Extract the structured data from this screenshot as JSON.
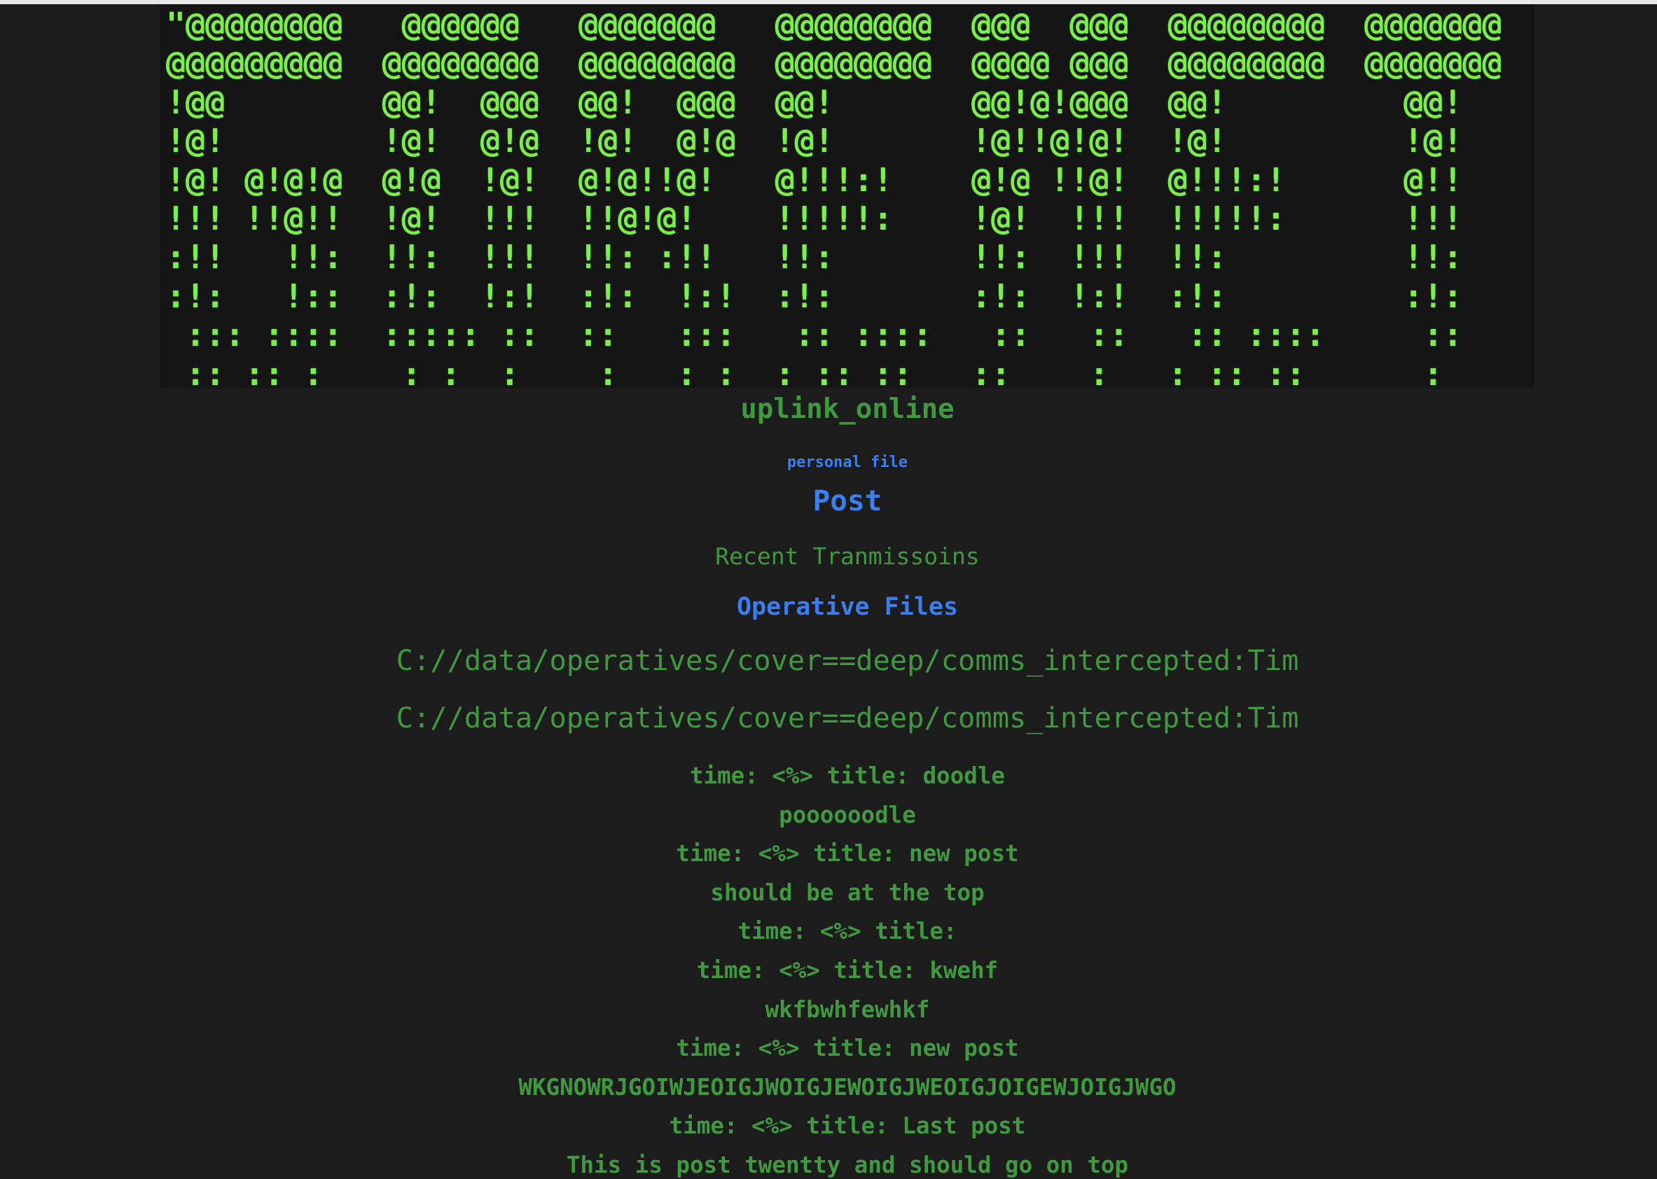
{
  "banner": {
    "lines": [
      "\"@@@@@@@@   @@@@@@   @@@@@@@   @@@@@@@@  @@@  @@@  @@@@@@@@  @@@@@@@",
      "@@@@@@@@@  @@@@@@@@  @@@@@@@@  @@@@@@@@  @@@@ @@@  @@@@@@@@  @@@@@@@",
      "!@@        @@!  @@@  @@!  @@@  @@!       @@!@!@@@  @@!         @@!",
      "!@!        !@!  @!@  !@!  @!@  !@!       !@!!@!@!  !@!         !@!",
      "!@! @!@!@  @!@  !@!  @!@!!@!   @!!!:!    @!@ !!@!  @!!!:!      @!!",
      "!!! !!@!!  !@!  !!!  !!@!@!    !!!!!:    !@!  !!!  !!!!!:      !!!",
      ":!!   !!:  !!:  !!!  !!: :!!   !!:       !!:  !!!  !!:         !!:",
      ":!:   !::  :!:  !:!  :!:  !:!  :!:       :!:  !:!  :!:         :!:",
      " ::: ::::  ::::: ::  ::   :::   :: ::::   ::   ::   :: ::::     ::",
      " :: :: :    : :  :    :   : :  : :: ::   ::    :   : :: ::      :"
    ]
  },
  "status": "uplink_online",
  "nav": {
    "personal_file": "personal file",
    "post": "Post",
    "recent": "Recent Tranmissoins",
    "operative_files": "Operative Files"
  },
  "paths": [
    "C://data/operatives/cover==deep/comms_intercepted:Tim",
    "C://data/operatives/cover==deep/comms_intercepted:Tim"
  ],
  "feed": [
    {
      "kind": "time",
      "text": "time: <%> title: doodle"
    },
    {
      "kind": "body",
      "text": "poooooodle"
    },
    {
      "kind": "time",
      "text": "time: <%> title: new post"
    },
    {
      "kind": "body",
      "text": "should be at the top"
    },
    {
      "kind": "time",
      "text": "time: <%> title:"
    },
    {
      "kind": "time",
      "text": "time: <%> title: kwehf"
    },
    {
      "kind": "body",
      "text": "wkfbwhfewhkf"
    },
    {
      "kind": "time",
      "text": "time: <%> title: new post"
    },
    {
      "kind": "body",
      "text": "WKGNOWRJGOIWJEOIGJWOIGJEWOIGJWEOIGJOIGEWJOIGJWGO"
    },
    {
      "kind": "time",
      "text": "time: <%> title: Last post"
    },
    {
      "kind": "body",
      "text": "This is post twentty and should go on top"
    }
  ],
  "colors": {
    "background": "#1c1c1c",
    "banner_green": "#7cf04a",
    "text_green": "#3f9a3f",
    "link_blue": "#3b7ef0"
  }
}
